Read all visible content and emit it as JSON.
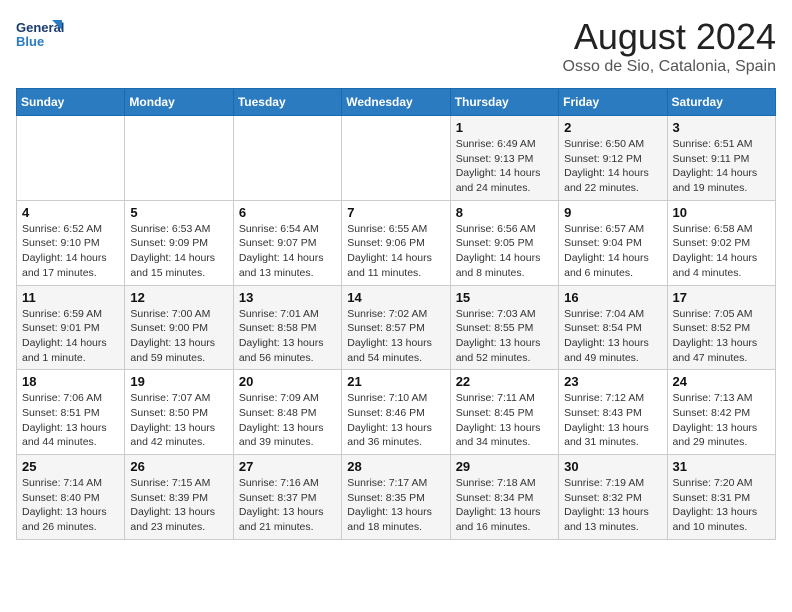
{
  "logo": {
    "line1": "General",
    "line2": "Blue"
  },
  "title": "August 2024",
  "subtitle": "Osso de Sio, Catalonia, Spain",
  "weekdays": [
    "Sunday",
    "Monday",
    "Tuesday",
    "Wednesday",
    "Thursday",
    "Friday",
    "Saturday"
  ],
  "weeks": [
    [
      {
        "day": "",
        "info": ""
      },
      {
        "day": "",
        "info": ""
      },
      {
        "day": "",
        "info": ""
      },
      {
        "day": "",
        "info": ""
      },
      {
        "day": "1",
        "info": "Sunrise: 6:49 AM\nSunset: 9:13 PM\nDaylight: 14 hours\nand 24 minutes."
      },
      {
        "day": "2",
        "info": "Sunrise: 6:50 AM\nSunset: 9:12 PM\nDaylight: 14 hours\nand 22 minutes."
      },
      {
        "day": "3",
        "info": "Sunrise: 6:51 AM\nSunset: 9:11 PM\nDaylight: 14 hours\nand 19 minutes."
      }
    ],
    [
      {
        "day": "4",
        "info": "Sunrise: 6:52 AM\nSunset: 9:10 PM\nDaylight: 14 hours\nand 17 minutes."
      },
      {
        "day": "5",
        "info": "Sunrise: 6:53 AM\nSunset: 9:09 PM\nDaylight: 14 hours\nand 15 minutes."
      },
      {
        "day": "6",
        "info": "Sunrise: 6:54 AM\nSunset: 9:07 PM\nDaylight: 14 hours\nand 13 minutes."
      },
      {
        "day": "7",
        "info": "Sunrise: 6:55 AM\nSunset: 9:06 PM\nDaylight: 14 hours\nand 11 minutes."
      },
      {
        "day": "8",
        "info": "Sunrise: 6:56 AM\nSunset: 9:05 PM\nDaylight: 14 hours\nand 8 minutes."
      },
      {
        "day": "9",
        "info": "Sunrise: 6:57 AM\nSunset: 9:04 PM\nDaylight: 14 hours\nand 6 minutes."
      },
      {
        "day": "10",
        "info": "Sunrise: 6:58 AM\nSunset: 9:02 PM\nDaylight: 14 hours\nand 4 minutes."
      }
    ],
    [
      {
        "day": "11",
        "info": "Sunrise: 6:59 AM\nSunset: 9:01 PM\nDaylight: 14 hours\nand 1 minute."
      },
      {
        "day": "12",
        "info": "Sunrise: 7:00 AM\nSunset: 9:00 PM\nDaylight: 13 hours\nand 59 minutes."
      },
      {
        "day": "13",
        "info": "Sunrise: 7:01 AM\nSunset: 8:58 PM\nDaylight: 13 hours\nand 56 minutes."
      },
      {
        "day": "14",
        "info": "Sunrise: 7:02 AM\nSunset: 8:57 PM\nDaylight: 13 hours\nand 54 minutes."
      },
      {
        "day": "15",
        "info": "Sunrise: 7:03 AM\nSunset: 8:55 PM\nDaylight: 13 hours\nand 52 minutes."
      },
      {
        "day": "16",
        "info": "Sunrise: 7:04 AM\nSunset: 8:54 PM\nDaylight: 13 hours\nand 49 minutes."
      },
      {
        "day": "17",
        "info": "Sunrise: 7:05 AM\nSunset: 8:52 PM\nDaylight: 13 hours\nand 47 minutes."
      }
    ],
    [
      {
        "day": "18",
        "info": "Sunrise: 7:06 AM\nSunset: 8:51 PM\nDaylight: 13 hours\nand 44 minutes."
      },
      {
        "day": "19",
        "info": "Sunrise: 7:07 AM\nSunset: 8:50 PM\nDaylight: 13 hours\nand 42 minutes."
      },
      {
        "day": "20",
        "info": "Sunrise: 7:09 AM\nSunset: 8:48 PM\nDaylight: 13 hours\nand 39 minutes."
      },
      {
        "day": "21",
        "info": "Sunrise: 7:10 AM\nSunset: 8:46 PM\nDaylight: 13 hours\nand 36 minutes."
      },
      {
        "day": "22",
        "info": "Sunrise: 7:11 AM\nSunset: 8:45 PM\nDaylight: 13 hours\nand 34 minutes."
      },
      {
        "day": "23",
        "info": "Sunrise: 7:12 AM\nSunset: 8:43 PM\nDaylight: 13 hours\nand 31 minutes."
      },
      {
        "day": "24",
        "info": "Sunrise: 7:13 AM\nSunset: 8:42 PM\nDaylight: 13 hours\nand 29 minutes."
      }
    ],
    [
      {
        "day": "25",
        "info": "Sunrise: 7:14 AM\nSunset: 8:40 PM\nDaylight: 13 hours\nand 26 minutes."
      },
      {
        "day": "26",
        "info": "Sunrise: 7:15 AM\nSunset: 8:39 PM\nDaylight: 13 hours\nand 23 minutes."
      },
      {
        "day": "27",
        "info": "Sunrise: 7:16 AM\nSunset: 8:37 PM\nDaylight: 13 hours\nand 21 minutes."
      },
      {
        "day": "28",
        "info": "Sunrise: 7:17 AM\nSunset: 8:35 PM\nDaylight: 13 hours\nand 18 minutes."
      },
      {
        "day": "29",
        "info": "Sunrise: 7:18 AM\nSunset: 8:34 PM\nDaylight: 13 hours\nand 16 minutes."
      },
      {
        "day": "30",
        "info": "Sunrise: 7:19 AM\nSunset: 8:32 PM\nDaylight: 13 hours\nand 13 minutes."
      },
      {
        "day": "31",
        "info": "Sunrise: 7:20 AM\nSunset: 8:31 PM\nDaylight: 13 hours\nand 10 minutes."
      }
    ]
  ]
}
